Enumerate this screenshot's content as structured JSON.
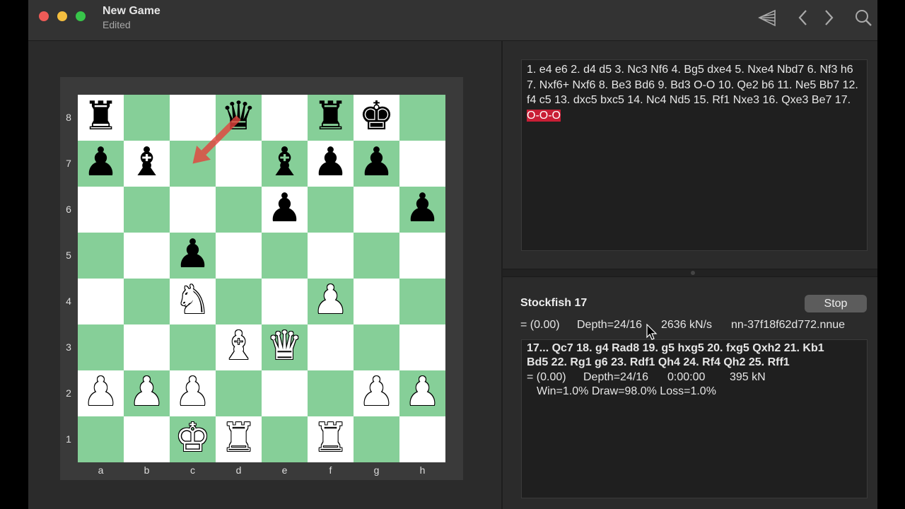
{
  "window": {
    "title": "New Game",
    "subtitle": "Edited"
  },
  "toolbar": {
    "icons": [
      "flag-icon",
      "chevron-left-icon",
      "chevron-right-icon",
      "search-icon"
    ]
  },
  "colors": {
    "light_square": "#ffffff",
    "dark_square": "#86cf98",
    "highlight": "#c81e35",
    "arrow": "#e3413c"
  },
  "board": {
    "ranks": [
      "8",
      "7",
      "6",
      "5",
      "4",
      "3",
      "2",
      "1"
    ],
    "files": [
      "a",
      "b",
      "c",
      "d",
      "e",
      "f",
      "g",
      "h"
    ],
    "pieces": [
      {
        "square": "a8",
        "glyph": "♜",
        "color": "b",
        "name": "black-rook-piece"
      },
      {
        "square": "d8",
        "glyph": "♛",
        "color": "b",
        "name": "black-queen-piece"
      },
      {
        "square": "f8",
        "glyph": "♜",
        "color": "b",
        "name": "black-rook-piece"
      },
      {
        "square": "g8",
        "glyph": "♚",
        "color": "b",
        "name": "black-king-piece"
      },
      {
        "square": "a7",
        "glyph": "♟",
        "color": "b",
        "name": "black-pawn-piece"
      },
      {
        "square": "b7",
        "glyph": "♝",
        "color": "b",
        "name": "black-bishop-piece"
      },
      {
        "square": "e7",
        "glyph": "♝",
        "color": "b",
        "name": "black-bishop-piece"
      },
      {
        "square": "f7",
        "glyph": "♟",
        "color": "b",
        "name": "black-pawn-piece"
      },
      {
        "square": "g7",
        "glyph": "♟",
        "color": "b",
        "name": "black-pawn-piece"
      },
      {
        "square": "e6",
        "glyph": "♟",
        "color": "b",
        "name": "black-pawn-piece"
      },
      {
        "square": "h6",
        "glyph": "♟",
        "color": "b",
        "name": "black-pawn-piece"
      },
      {
        "square": "c5",
        "glyph": "♟",
        "color": "b",
        "name": "black-pawn-piece"
      },
      {
        "square": "c4",
        "glyph": "♞",
        "color": "w",
        "name": "white-knight-piece"
      },
      {
        "square": "f4",
        "glyph": "♟",
        "color": "w",
        "name": "white-pawn-piece"
      },
      {
        "square": "d3",
        "glyph": "♝",
        "color": "w",
        "name": "white-bishop-piece"
      },
      {
        "square": "e3",
        "glyph": "♛",
        "color": "w",
        "name": "white-queen-piece"
      },
      {
        "square": "a2",
        "glyph": "♟",
        "color": "w",
        "name": "white-pawn-piece"
      },
      {
        "square": "b2",
        "glyph": "♟",
        "color": "w",
        "name": "white-pawn-piece"
      },
      {
        "square": "c2",
        "glyph": "♟",
        "color": "w",
        "name": "white-pawn-piece"
      },
      {
        "square": "g2",
        "glyph": "♟",
        "color": "w",
        "name": "white-pawn-piece"
      },
      {
        "square": "h2",
        "glyph": "♟",
        "color": "w",
        "name": "white-pawn-piece"
      },
      {
        "square": "c1",
        "glyph": "♚",
        "color": "w",
        "name": "white-king-piece"
      },
      {
        "square": "d1",
        "glyph": "♜",
        "color": "w",
        "name": "white-rook-piece"
      },
      {
        "square": "f1",
        "glyph": "♜",
        "color": "w",
        "name": "white-rook-piece"
      }
    ],
    "arrow": {
      "from": "d8",
      "to": "c7"
    }
  },
  "moves": {
    "text": "1. e4 e6 2. d4 d5 3. Nc3 Nf6 4. Bg5 dxe4 5. Nxe4 Nbd7 6. Nf3 h6 7. Nxf6+ Nxf6 8. Be3 Bd6 9. Bd3 O-O 10. Qe2 b6 11. Ne5 Bb7 12. f4 c5 13. dxc5 bxc5 14. Nc4 Nd5 15. Rf1 Nxe3 16. Qxe3 Be7 17. ",
    "current": "O-O-O"
  },
  "engine": {
    "name": "Stockfish 17",
    "stop_label": "Stop",
    "eval": "= (0.00)",
    "depth": "Depth=24/16",
    "speed": "2636 kN/s",
    "network": "nn-37f18f62d772.nnue",
    "pv": {
      "line1": "17... Qc7 18. g4 Rad8 19. g5 hxg5 20. fxg5 Qxh2 21. Kb1",
      "line2": "Bd5 22. Rg1 g6 23. Rdf1 Qh4 24. Rf4 Qh2 25. Rff1",
      "eval": "= (0.00)",
      "depth": "Depth=24/16",
      "time": "0:00:00",
      "nodes": "395 kN",
      "wdl": "Win=1.0% Draw=98.0% Loss=1.0%"
    }
  }
}
